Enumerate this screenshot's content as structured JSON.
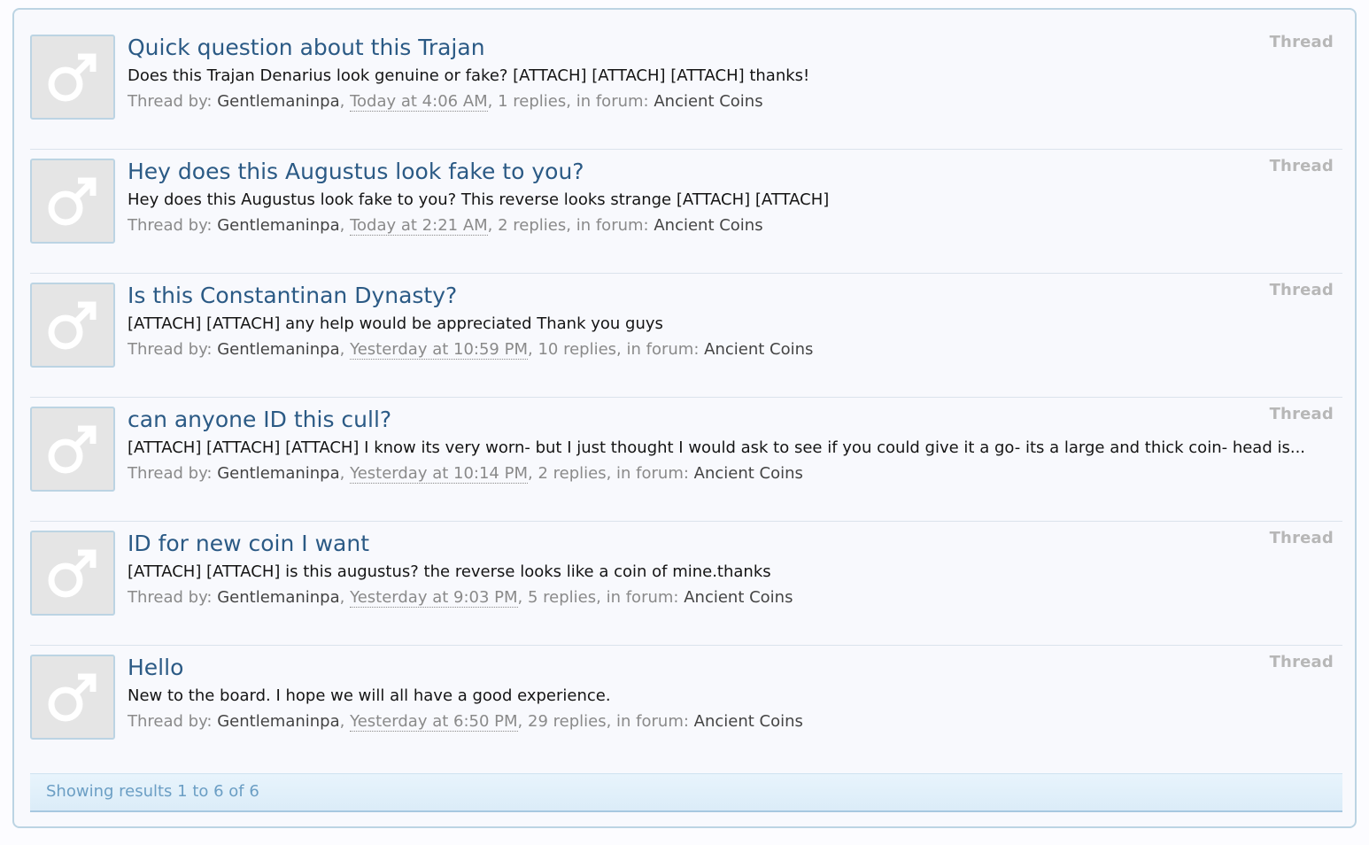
{
  "results": [
    {
      "title": "Quick question about this Trajan",
      "snippet": "Does this Trajan Denarius look genuine or fake? [ATTACH] [ATTACH] [ATTACH] thanks!",
      "by_label": "Thread by:",
      "author": "Gentlemaninpa",
      "time": "Today at 4:06 AM",
      "replies": "1 replies",
      "forum_label": "in forum:",
      "forum": "Ancient Coins",
      "type": "Thread"
    },
    {
      "title": "Hey does this Augustus look fake to you?",
      "snippet": "Hey does this Augustus look fake to you? This reverse looks strange [ATTACH] [ATTACH]",
      "by_label": "Thread by:",
      "author": "Gentlemaninpa",
      "time": "Today at 2:21 AM",
      "replies": "2 replies",
      "forum_label": "in forum:",
      "forum": "Ancient Coins",
      "type": "Thread"
    },
    {
      "title": "Is this Constantinan Dynasty?",
      "snippet": "[ATTACH] [ATTACH] any help would be appreciated Thank you guys",
      "by_label": "Thread by:",
      "author": "Gentlemaninpa",
      "time": "Yesterday at 10:59 PM",
      "replies": "10 replies",
      "forum_label": "in forum:",
      "forum": "Ancient Coins",
      "type": "Thread"
    },
    {
      "title": "can anyone ID this cull?",
      "snippet": "[ATTACH] [ATTACH] [ATTACH] I know its very worn- but I just thought I would ask to see if you could give it a go- its a large and thick coin- head is...",
      "by_label": "Thread by:",
      "author": "Gentlemaninpa",
      "time": "Yesterday at 10:14 PM",
      "replies": "2 replies",
      "forum_label": "in forum:",
      "forum": "Ancient Coins",
      "type": "Thread"
    },
    {
      "title": "ID for new coin I want",
      "snippet": "[ATTACH] [ATTACH] is this augustus? the reverse looks like a coin of mine.thanks",
      "by_label": "Thread by:",
      "author": "Gentlemaninpa",
      "time": "Yesterday at 9:03 PM",
      "replies": "5 replies",
      "forum_label": "in forum:",
      "forum": "Ancient Coins",
      "type": "Thread"
    },
    {
      "title": "Hello",
      "snippet": "New to the board. I hope we will all have a good experience.",
      "by_label": "Thread by:",
      "author": "Gentlemaninpa",
      "time": "Yesterday at 6:50 PM",
      "replies": "29 replies",
      "forum_label": "in forum:",
      "forum": "Ancient Coins",
      "type": "Thread"
    }
  ],
  "footer": {
    "summary": "Showing results 1 to 6 of 6"
  },
  "icons": {
    "avatar": "male-symbol-icon"
  },
  "colors": {
    "title_link": "#2b5a85",
    "border": "#bcd4e3",
    "footer_text": "#6b9ec4"
  }
}
